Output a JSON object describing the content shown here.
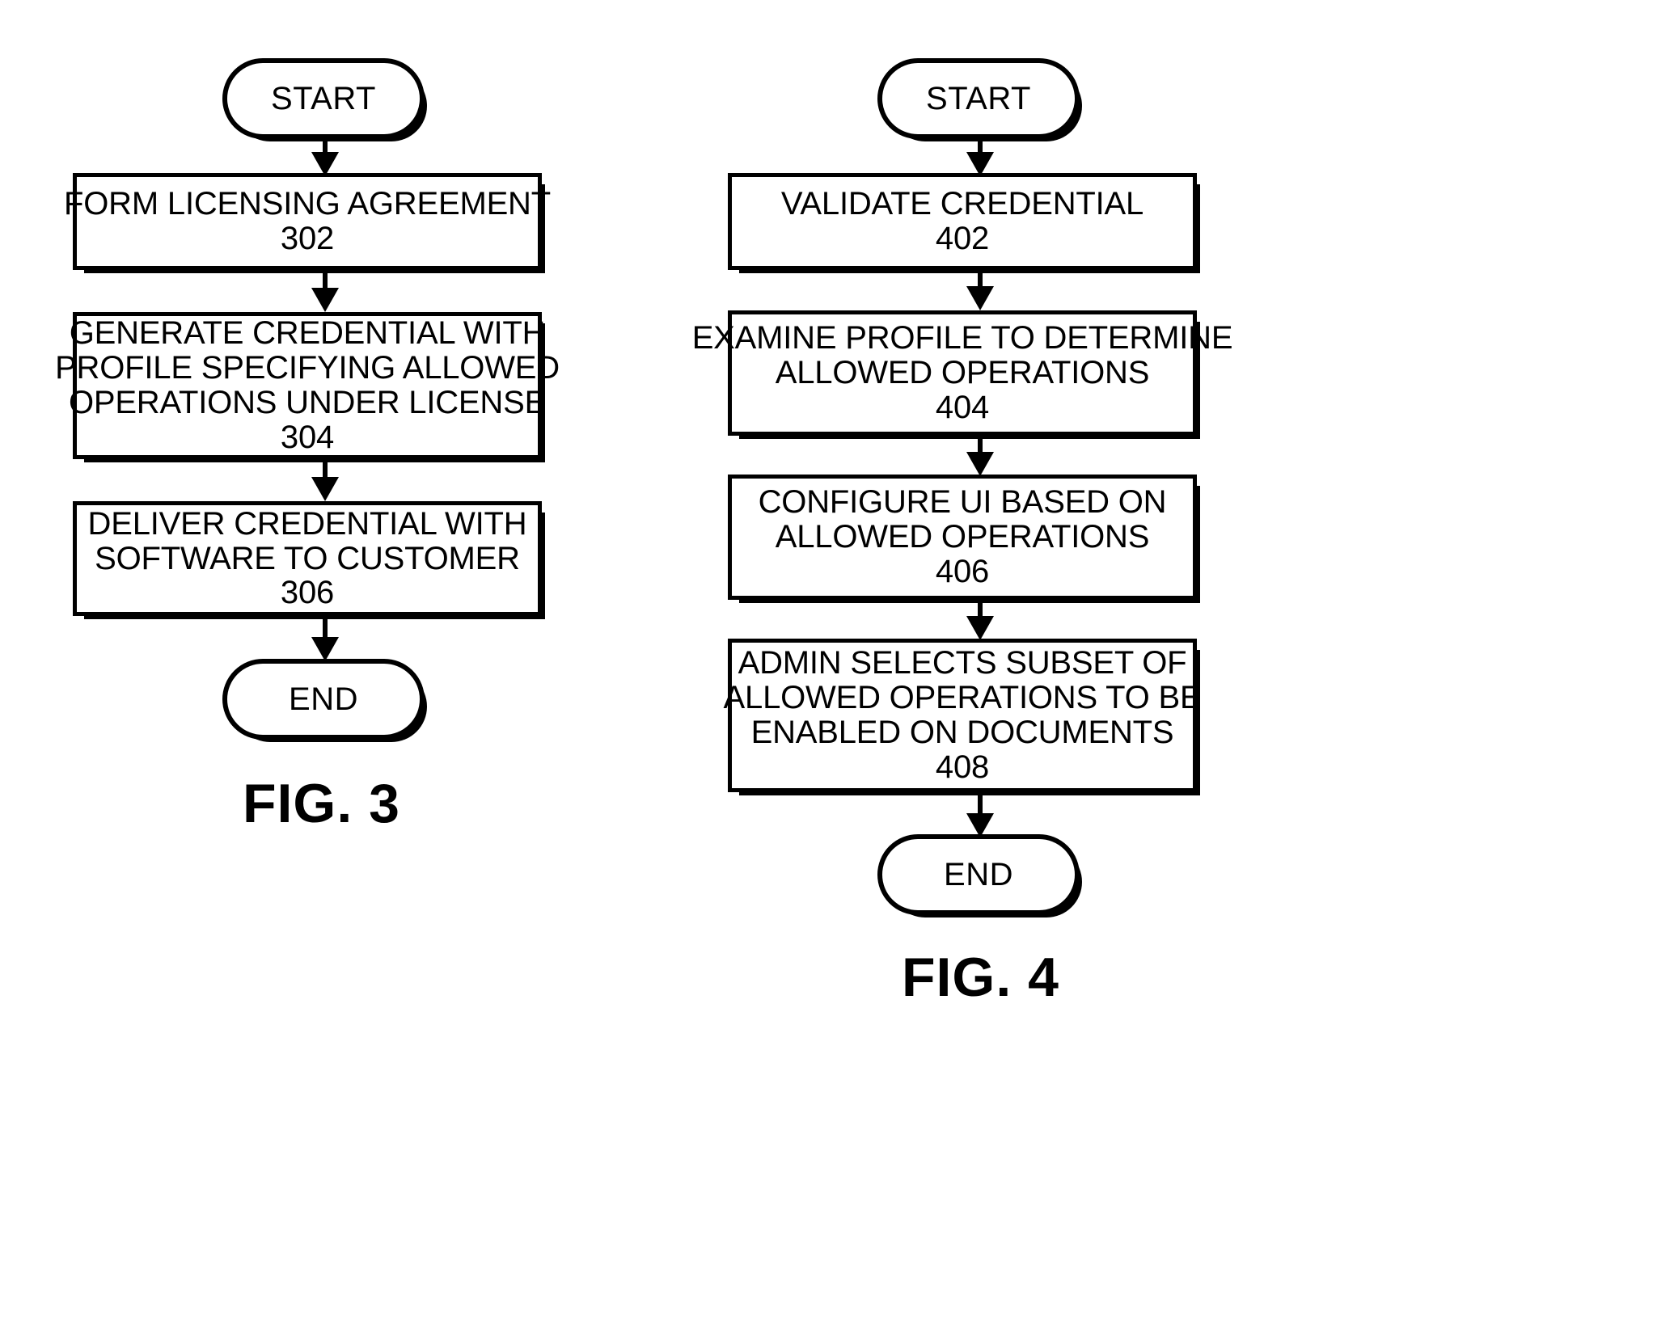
{
  "figures": [
    {
      "id": "fig3",
      "caption": "FIG. 3",
      "start_label": "START",
      "end_label": "END",
      "steps": [
        {
          "ref": "302",
          "lines": [
            "FORM LICENSING AGREEMENT"
          ]
        },
        {
          "ref": "304",
          "lines": [
            "GENERATE CREDENTIAL WITH",
            "PROFILE SPECIFYING ALLOWED",
            "OPERATIONS UNDER LICENSE"
          ]
        },
        {
          "ref": "306",
          "lines": [
            "DELIVER CREDENTIAL WITH",
            "SOFTWARE TO CUSTOMER"
          ]
        }
      ]
    },
    {
      "id": "fig4",
      "caption": "FIG. 4",
      "start_label": "START",
      "end_label": "END",
      "steps": [
        {
          "ref": "402",
          "lines": [
            "VALIDATE CREDENTIAL"
          ]
        },
        {
          "ref": "404",
          "lines": [
            "EXAMINE PROFILE TO DETERMINE",
            "ALLOWED OPERATIONS"
          ]
        },
        {
          "ref": "406",
          "lines": [
            "CONFIGURE UI BASED ON",
            "ALLOWED OPERATIONS"
          ]
        },
        {
          "ref": "408",
          "lines": [
            "ADMIN SELECTS SUBSET OF",
            "ALLOWED OPERATIONS TO BE",
            "ENABLED ON DOCUMENTS"
          ]
        }
      ]
    }
  ],
  "colors": {
    "ink": "#000000",
    "paper": "#ffffff"
  }
}
